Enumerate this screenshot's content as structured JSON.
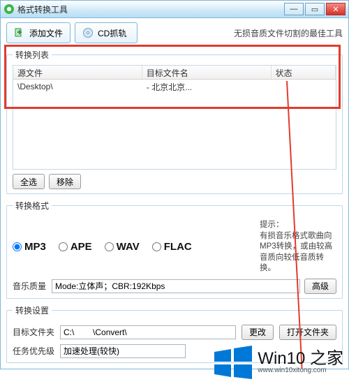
{
  "window": {
    "title": "格式转换工具",
    "min_glyph": "—",
    "max_glyph": "▭",
    "close_glyph": "✕"
  },
  "toolbar": {
    "add_files_label": "添加文件",
    "cd_grab_label": "CD抓轨",
    "tagline": "无损音质文件切割的最佳工具"
  },
  "list": {
    "legend": "转换列表",
    "headers": {
      "src": "源文件",
      "target": "目标文件名",
      "status": "状态"
    },
    "rows": [
      {
        "src": "\\Desktop\\",
        "target": "- 北京北京...",
        "status": ""
      }
    ],
    "btn_select_all": "全选",
    "btn_remove": "移除"
  },
  "format": {
    "legend": "转换格式",
    "options": {
      "mp3": "MP3",
      "ape": "APE",
      "wav": "WAV",
      "flac": "FLAC"
    },
    "selected": "mp3",
    "quality_label": "音乐质量",
    "quality_value": "Mode:立体声；CBR:192Kbps",
    "advanced_btn": "高级",
    "hint": "提示：\n有损音乐格式歌曲向MP3转换，或由较高音质向较低音质转换。"
  },
  "settings": {
    "legend": "转换设置",
    "target_folder_label": "目标文件夹",
    "target_folder_value": "C:\\        \\Convert\\",
    "change_btn": "更改",
    "open_folder_btn": "打开文件夹",
    "priority_label": "任务优先级",
    "priority_value": "加速处理(较快)"
  },
  "watermark": {
    "brand": "Win10 之家",
    "url": "www.win10xitong.com"
  }
}
